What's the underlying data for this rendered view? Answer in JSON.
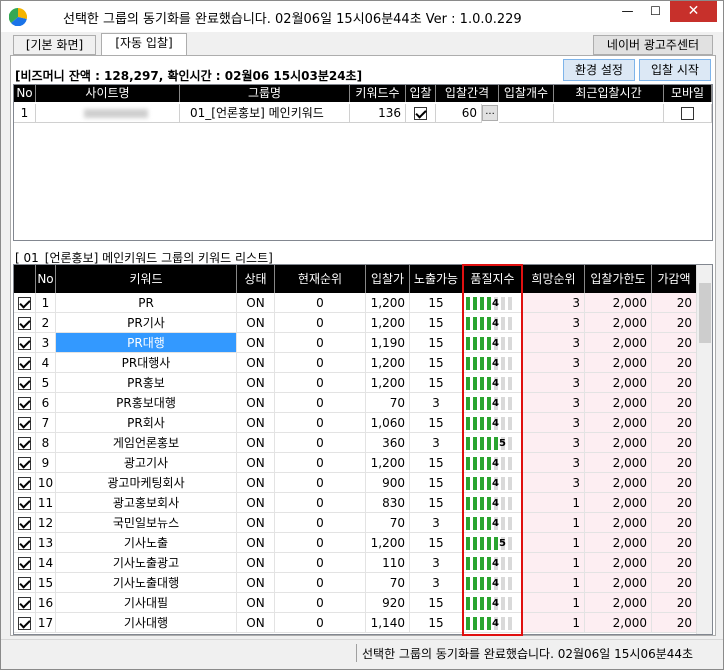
{
  "window": {
    "title": "선택한 그룹의 동기화를 완료했습니다. 02월06일 15시06분44초 Ver : 1.0.0.229",
    "minimize": "—",
    "maximize": "☐",
    "close": "✕"
  },
  "tabs": [
    {
      "label": "[기본 화면]"
    },
    {
      "label": "[자동 입찰]"
    }
  ],
  "toolbar": {
    "naver_center": "네이버 광고주센터",
    "settings": "환경 설정",
    "start_bid": "입찰 시작"
  },
  "balance_text": "[비즈머니 잔액 : 128,297, 확인시간 : 02월06 15시03분24초]",
  "site_grid": {
    "headers": [
      "No",
      "사이트명",
      "그룹명",
      "키워드수",
      "입찰",
      "입찰간격",
      "입찰개수",
      "최근입찰시간",
      "모바일"
    ],
    "rows": [
      {
        "no": "1",
        "site": "",
        "group": "01_[언론홍보] 메인키워드",
        "keyword_count": "136",
        "bid": true,
        "interval": "60",
        "interval_btn": "...",
        "bid_count": "",
        "last_bid": "",
        "mobile": false
      }
    ]
  },
  "keyword_list_label": "[ 01_[언론홍보] 메인키워드 그룹의 키워드 리스트]",
  "keyword_grid": {
    "headers": [
      "",
      "No",
      "키워드",
      "상태",
      "현재순위",
      "입찰가",
      "노출가능",
      "품질지수",
      "희망순위",
      "입찰가한도",
      "가감액"
    ],
    "rows": [
      {
        "checked": true,
        "no": "1",
        "keyword": "PR",
        "status": "ON",
        "rank": "0",
        "bid": "1,200",
        "exposure": "15",
        "quality": 4,
        "quality_label": "4",
        "hope_rank": "3",
        "limit": "2,000",
        "delta": "20"
      },
      {
        "checked": true,
        "no": "2",
        "keyword": "PR기사",
        "status": "ON",
        "rank": "0",
        "bid": "1,200",
        "exposure": "15",
        "quality": 4,
        "quality_label": "4",
        "hope_rank": "3",
        "limit": "2,000",
        "delta": "20"
      },
      {
        "checked": true,
        "no": "3",
        "keyword": "PR대행",
        "status": "ON",
        "rank": "0",
        "bid": "1,190",
        "exposure": "15",
        "quality": 4,
        "quality_label": "4",
        "hope_rank": "3",
        "limit": "2,000",
        "delta": "20",
        "selected": true
      },
      {
        "checked": true,
        "no": "4",
        "keyword": "PR대행사",
        "status": "ON",
        "rank": "0",
        "bid": "1,200",
        "exposure": "15",
        "quality": 4,
        "quality_label": "4",
        "hope_rank": "3",
        "limit": "2,000",
        "delta": "20"
      },
      {
        "checked": true,
        "no": "5",
        "keyword": "PR홍보",
        "status": "ON",
        "rank": "0",
        "bid": "1,200",
        "exposure": "15",
        "quality": 4,
        "quality_label": "4",
        "hope_rank": "3",
        "limit": "2,000",
        "delta": "20"
      },
      {
        "checked": true,
        "no": "6",
        "keyword": "PR홍보대행",
        "status": "ON",
        "rank": "0",
        "bid": "70",
        "exposure": "3",
        "quality": 4,
        "quality_label": "4",
        "hope_rank": "3",
        "limit": "2,000",
        "delta": "20"
      },
      {
        "checked": true,
        "no": "7",
        "keyword": "PR회사",
        "status": "ON",
        "rank": "0",
        "bid": "1,060",
        "exposure": "15",
        "quality": 4,
        "quality_label": "4",
        "hope_rank": "3",
        "limit": "2,000",
        "delta": "20"
      },
      {
        "checked": true,
        "no": "8",
        "keyword": "게임언론홍보",
        "status": "ON",
        "rank": "0",
        "bid": "360",
        "exposure": "3",
        "quality": 5,
        "quality_label": "5",
        "hope_rank": "3",
        "limit": "2,000",
        "delta": "20"
      },
      {
        "checked": true,
        "no": "9",
        "keyword": "광고기사",
        "status": "ON",
        "rank": "0",
        "bid": "1,200",
        "exposure": "15",
        "quality": 4,
        "quality_label": "4",
        "hope_rank": "3",
        "limit": "2,000",
        "delta": "20"
      },
      {
        "checked": true,
        "no": "10",
        "keyword": "광고마케팅회사",
        "status": "ON",
        "rank": "0",
        "bid": "900",
        "exposure": "15",
        "quality": 4,
        "quality_label": "4",
        "hope_rank": "3",
        "limit": "2,000",
        "delta": "20"
      },
      {
        "checked": true,
        "no": "11",
        "keyword": "광고홍보회사",
        "status": "ON",
        "rank": "0",
        "bid": "830",
        "exposure": "15",
        "quality": 4,
        "quality_label": "4",
        "hope_rank": "1",
        "limit": "2,000",
        "delta": "20"
      },
      {
        "checked": true,
        "no": "12",
        "keyword": "국민일보뉴스",
        "status": "ON",
        "rank": "0",
        "bid": "70",
        "exposure": "3",
        "quality": 4,
        "quality_label": "4",
        "hope_rank": "1",
        "limit": "2,000",
        "delta": "20"
      },
      {
        "checked": true,
        "no": "13",
        "keyword": "기사노출",
        "status": "ON",
        "rank": "0",
        "bid": "1,200",
        "exposure": "15",
        "quality": 5,
        "quality_label": "5",
        "hope_rank": "1",
        "limit": "2,000",
        "delta": "20"
      },
      {
        "checked": true,
        "no": "14",
        "keyword": "기사노출광고",
        "status": "ON",
        "rank": "0",
        "bid": "110",
        "exposure": "3",
        "quality": 4,
        "quality_label": "4",
        "hope_rank": "1",
        "limit": "2,000",
        "delta": "20"
      },
      {
        "checked": true,
        "no": "15",
        "keyword": "기사노출대행",
        "status": "ON",
        "rank": "0",
        "bid": "70",
        "exposure": "3",
        "quality": 4,
        "quality_label": "4",
        "hope_rank": "1",
        "limit": "2,000",
        "delta": "20"
      },
      {
        "checked": true,
        "no": "16",
        "keyword": "기사대필",
        "status": "ON",
        "rank": "0",
        "bid": "920",
        "exposure": "15",
        "quality": 4,
        "quality_label": "4",
        "hope_rank": "1",
        "limit": "2,000",
        "delta": "20"
      },
      {
        "checked": true,
        "no": "17",
        "keyword": "기사대행",
        "status": "ON",
        "rank": "0",
        "bid": "1,140",
        "exposure": "15",
        "quality": 4,
        "quality_label": "4",
        "hope_rank": "1",
        "limit": "2,000",
        "delta": "20"
      }
    ]
  },
  "quality_scale_max": 7,
  "colors": {
    "quality_on": "#2aa530",
    "quality_off": "#d9d9d9",
    "selected_row": "#3399ff",
    "highlight_box": "#e01010",
    "pink_columns": "#fdeef2"
  },
  "status_bar": "선택한 그룹의 동기화를 완료했습니다. 02월06일 15시06분44초"
}
